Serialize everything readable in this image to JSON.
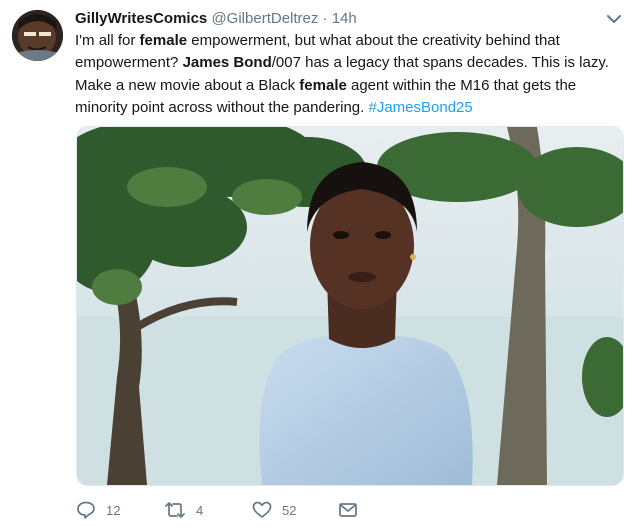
{
  "tweet": {
    "author_name": "GillyWritesComics",
    "handle": "@GilbertDeltrez",
    "separator": "·",
    "time": "14h",
    "text": {
      "p1": "I'm all for ",
      "b1": "female",
      "p2": " empowerment, but what about the creativity behind that empowerment? ",
      "b2": "James Bond",
      "p3": "/007 has a legacy that spans decades. This is lazy. Make a new movie about a Black ",
      "b3": "female",
      "p4": " agent within the M16 that gets the minority point across without the pandering. ",
      "hashtag": "#JamesBond25"
    },
    "actions": {
      "replies": "12",
      "retweets": "4",
      "likes": "52"
    }
  },
  "icons": {
    "options": "chevron-down-icon",
    "reply": "reply-icon",
    "retweet": "retweet-icon",
    "like": "heart-icon",
    "dm": "envelope-icon"
  },
  "colors": {
    "link": "#1da1f2",
    "secondary_text": "#657786",
    "primary_text": "#14171a"
  }
}
